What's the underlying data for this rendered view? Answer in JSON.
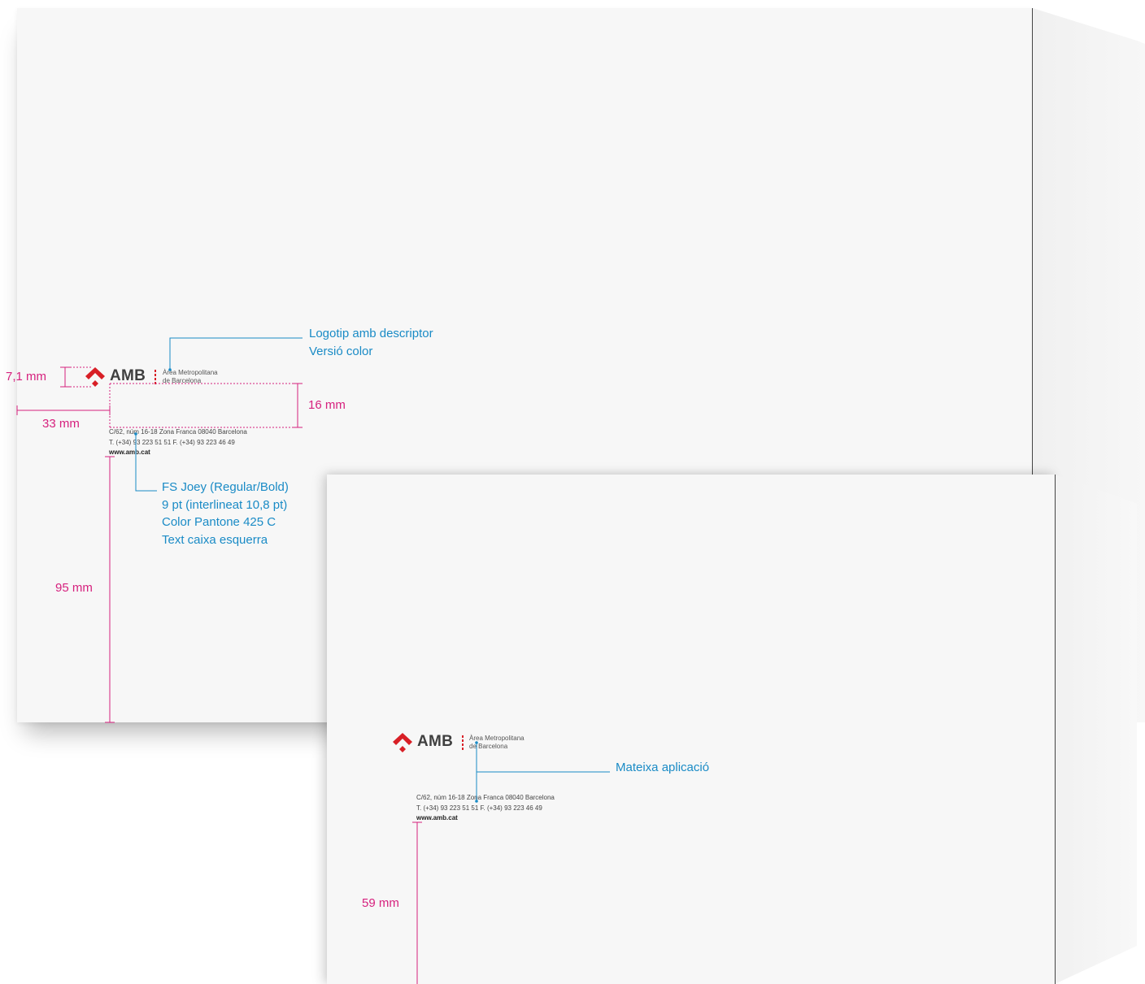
{
  "envelope_large": {
    "logo": {
      "mark_color": "#d81f26",
      "wordmark": "AMB",
      "descriptor_line1": "Àrea Metropolitana",
      "descriptor_line2": "de Barcelona"
    },
    "address": {
      "line1": "C/62, núm 16-18   Zona Franca   08040 Barcelona",
      "line2": "T. (+34) 93 223 51 51   F. (+34) 93 223 46 49",
      "web": "www.amb.cat"
    },
    "dimensions": {
      "logo_height": "7,1 mm",
      "left_margin": "33 mm",
      "gap_logo_to_text": "16 mm",
      "bottom_margin": "95 mm"
    },
    "callouts": {
      "logo_line1": "Logotip amb descriptor",
      "logo_line2": "Versió color",
      "font_line1": "FS Joey (Regular/Bold)",
      "font_line2": "9 pt (interlineat 10,8 pt)",
      "font_line3": "Color Pantone 425 C",
      "font_line4": "Text caixa esquerra"
    }
  },
  "envelope_small": {
    "logo": {
      "wordmark": "AMB",
      "descriptor_line1": "Àrea Metropolitana",
      "descriptor_line2": "de Barcelona"
    },
    "address": {
      "line1": "C/62, núm 16-18   Zona Franca   08040 Barcelona",
      "line2": "T. (+34) 93 223 51 51   F. (+34) 93 223 46 49",
      "web": "www.amb.cat"
    },
    "dimensions": {
      "bottom_margin": "59 mm"
    },
    "callouts": {
      "same_application": "Mateixa aplicació"
    }
  },
  "colors": {
    "dimension": "#d6217e",
    "callout": "#1a8bc6",
    "paper": "#f7f7f7",
    "logo_red": "#d81f26",
    "logo_grey": "#3f3f3f"
  }
}
